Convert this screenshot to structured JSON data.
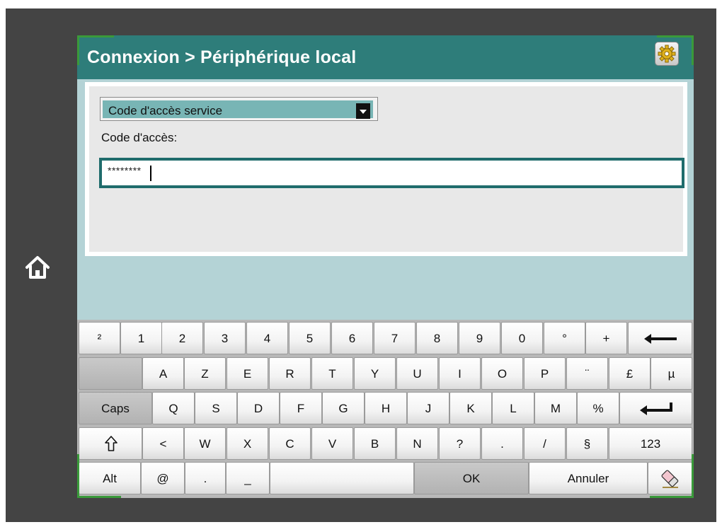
{
  "screen": {
    "title": "Connexion > Périphérique local",
    "settings_icon": "gear-icon",
    "home_icon": "home-icon"
  },
  "form": {
    "dropdown_value": "Code d'accès service",
    "code_label": "Code d'accès:",
    "code_value": "********"
  },
  "keyboard": {
    "row1": [
      "²",
      "1",
      "2",
      "3",
      "4",
      "5",
      "6",
      "7",
      "8",
      "9",
      "0",
      "°",
      "+"
    ],
    "row2": [
      "A",
      "Z",
      "E",
      "R",
      "T",
      "Y",
      "U",
      "I",
      "O",
      "P",
      "¨",
      "£",
      "µ"
    ],
    "row3_caps": "Caps",
    "row3": [
      "Q",
      "S",
      "D",
      "F",
      "G",
      "H",
      "J",
      "K",
      "L",
      "M",
      "%"
    ],
    "row4": [
      "<",
      "W",
      "X",
      "C",
      "V",
      "B",
      "N",
      "?",
      ".",
      "/",
      "§"
    ],
    "row4_numeric": "123",
    "row5": [
      "Alt",
      "@",
      ".",
      "_"
    ],
    "ok": "OK",
    "cancel": "Annuler",
    "icons": {
      "backspace": "backspace-arrow-icon",
      "enter": "enter-arrow-icon",
      "shift": "shift-arrow-icon",
      "clear": "eraser-icon"
    }
  },
  "colors": {
    "title_bar": "#2e7d7a",
    "screen_background": "#b4d3d6",
    "dropdown_fill": "#78b5b5",
    "input_border": "#1f6c6c",
    "corner_accent": "#3a9a3a"
  }
}
